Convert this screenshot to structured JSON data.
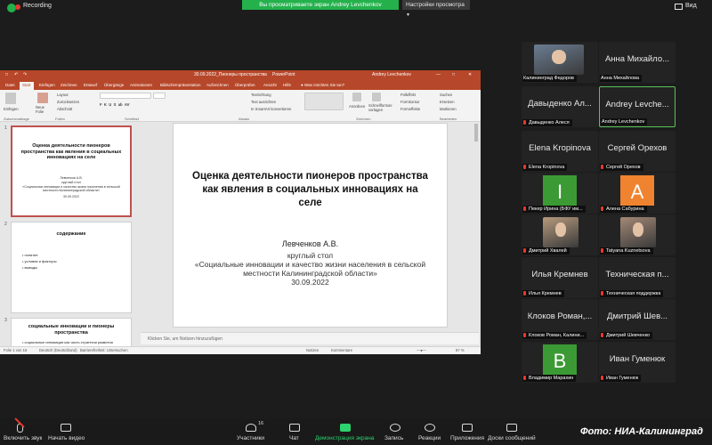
{
  "zoom": {
    "recording": "Recording",
    "viewing_banner": "Вы просматриваете экран Andrey Levchenkov",
    "view_options": "Настройки просмотра",
    "view_button": "Вид",
    "colors": {
      "banner": "#24b14c",
      "rec": "#e8382f"
    }
  },
  "ppt": {
    "titlebar": {
      "doc": "30.09.2022_Пионеры пространства",
      "app": "PowerPoint",
      "user": "Andrey Levchenkov"
    },
    "tabs": [
      "Datei",
      "Start",
      "Einfügen",
      "Zeichnen",
      "Entwurf",
      "Übergänge",
      "Animationen",
      "Bildschirmpräsentation",
      "Aufzeichnen",
      "Überprüfen",
      "Ansicht",
      "Hilfe"
    ],
    "tell_me": "Was möchten Sie tun?",
    "ribbon": {
      "paste": "Einfügen",
      "new_slide": "Neue Folie",
      "layout": "Layout",
      "reset": "Zurücksetzen",
      "section": "Abschnitt",
      "arrange": "Anordnen",
      "quick_styles": "Schnellformat-vorlagen",
      "fill": "Fülleffekt",
      "outline": "Formkontur",
      "effects": "Formeffekte",
      "search": "Suchen",
      "replace": "Ersetzen",
      "select": "Markieren",
      "text_direction": "Textrichtung",
      "align_text": "Text ausrichten",
      "smartart": "In SmartArt konvertieren",
      "groups": [
        "Zwischenablage",
        "Folien",
        "Schriftart",
        "Absatz",
        "Zeichnen",
        "Bearbeiten"
      ]
    },
    "thumbnails": [
      {
        "num": "1",
        "title": "Оценка деятельности пионеров пространства как явления в социальных инновациях на селе",
        "lines": [
          "Левченков А.В.",
          "круглый стол",
          "«Социальные инновации и качество жизни населения в сельской местности Калининградской области»",
          "30.09.2022"
        ]
      },
      {
        "num": "2",
        "title": "содержание",
        "bullets": [
          "понятие",
          "условия и факторы",
          "выводы"
        ]
      },
      {
        "num": "3",
        "title": "социальные инновации и пионеры пространства",
        "bullets": [
          "социальные инновации как часть стратегии развития"
        ]
      }
    ],
    "slide": {
      "title": "Оценка деятельности пионеров пространства как явления в социальных инновациях на селе",
      "author": "Левченков А.В.",
      "subtitle_1": "круглый стол",
      "subtitle_2": "«Социальные инновации и качество жизни населения в сельской местности Калининградской области»",
      "date": "30.09.2022"
    },
    "notes_placeholder": "Klicken Sie, um Notizen hinzuzufügen",
    "statusbar": {
      "slide_count": "Folie 1 von 16",
      "language": "Deutsch (Deutschland)",
      "accessibility": "Barrierefreiheit: Untersuchen",
      "notes": "Notizen",
      "comments": "Kommentare",
      "zoom": "87 %"
    }
  },
  "participants": [
    {
      "display": "",
      "label": "Калининград Федоров",
      "muted": false,
      "kind": "photo",
      "color": "#6b7d92"
    },
    {
      "display": "Анна Михайло...",
      "label": "Анна Михайлова",
      "muted": false,
      "kind": "name"
    },
    {
      "display": "Давыденко Ал...",
      "label": "Давыденко Алеся",
      "muted": true,
      "kind": "name"
    },
    {
      "display": "Andrey Levche...",
      "label": "Andrey Levchenkov",
      "muted": false,
      "kind": "name",
      "active": true
    },
    {
      "display": "Elena Kropinova",
      "label": "Elena Kropinova",
      "muted": true,
      "kind": "name"
    },
    {
      "display": "Сергей Орехов",
      "label": "Сергей Орехов",
      "muted": true,
      "kind": "name"
    },
    {
      "display": "I",
      "label": "Пекер Ирина (БФУ им...",
      "muted": true,
      "kind": "letter",
      "color": "#3c9a35"
    },
    {
      "display": "A",
      "label": "Алена Сабурина",
      "muted": true,
      "kind": "letter",
      "color": "#f0832f"
    },
    {
      "display": "",
      "label": "Дмитрий Хвалей",
      "muted": true,
      "kind": "photo",
      "color": "#b69a7d"
    },
    {
      "display": "",
      "label": "Tatyana Kuznetsova",
      "muted": true,
      "kind": "photo",
      "color": "#a48876"
    },
    {
      "display": "Илья Кремнев",
      "label": "Илья Кремнев",
      "muted": true,
      "kind": "name"
    },
    {
      "display": "Техническая п...",
      "label": "Техническая поддержка",
      "muted": true,
      "kind": "name"
    },
    {
      "display": "Клоков Роман,...",
      "label": "Клоков Роман, Калини...",
      "muted": true,
      "kind": "name"
    },
    {
      "display": "Дмитрий Шев...",
      "label": "Дмитрий Шевченко",
      "muted": true,
      "kind": "name"
    },
    {
      "display": "B",
      "label": "Владимир Марахин",
      "muted": true,
      "kind": "letter",
      "color": "#3c9a35"
    },
    {
      "display": "Иван Гуменюк",
      "label": "Иван Гуменюк",
      "muted": true,
      "kind": "name"
    }
  ],
  "toolbar": {
    "unmute": "Включить звук",
    "start_video": "Начать видео",
    "participants": "Участники",
    "participants_count": "16",
    "chat": "Чат",
    "share": "Демонстрация экрана",
    "record": "Запись",
    "reactions": "Реакции",
    "apps": "Приложения",
    "whiteboards": "Доски сообщений"
  },
  "watermark": "Фото: НИА-Калининград"
}
